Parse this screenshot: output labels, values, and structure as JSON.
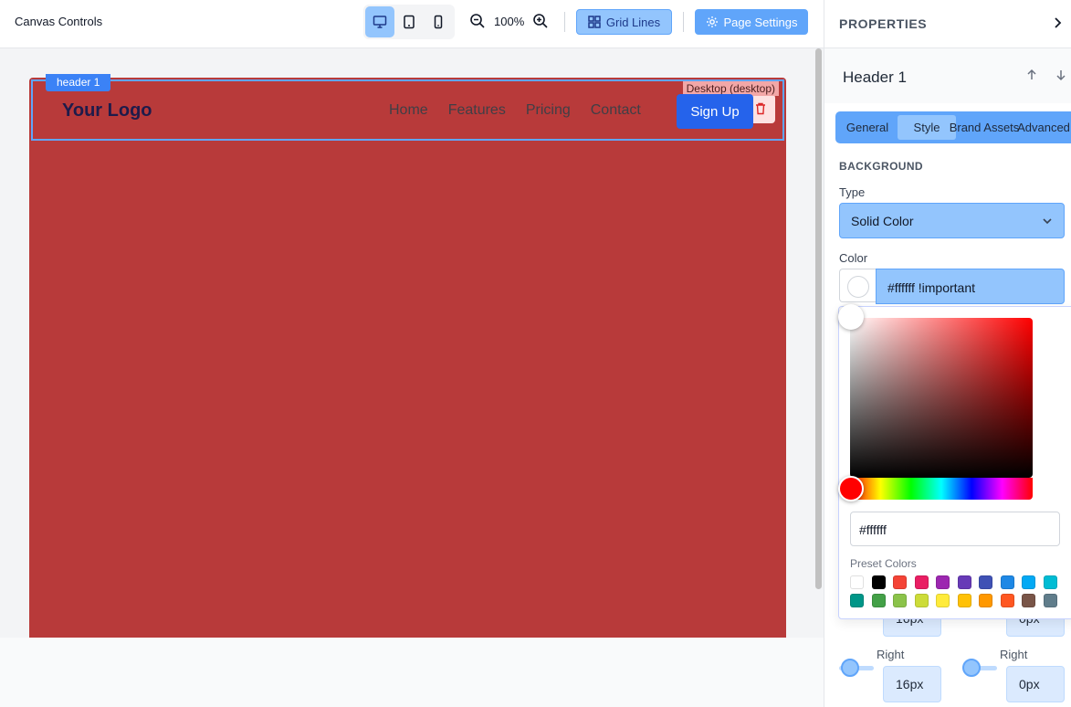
{
  "toolbar": {
    "title": "Canvas Controls",
    "zoom_level": "100%",
    "grid_lines_label": "Grid Lines",
    "page_settings_label": "Page Settings",
    "active_device": "desktop"
  },
  "canvas": {
    "header_tag": "header 1",
    "device_tag": "Desktop (desktop)",
    "logo": "Your Logo",
    "nav": [
      "Home",
      "Features",
      "Pricing",
      "Contact"
    ],
    "cta": "Sign Up",
    "header_bg": "#b83a3a"
  },
  "panel": {
    "title": "PROPERTIES",
    "component_name": "Header 1",
    "tabs": [
      "General",
      "Style",
      "Brand Assets",
      "Advanced"
    ],
    "active_tab": "Style",
    "section": "BACKGROUND",
    "type_label": "Type",
    "type_value": "Solid Color",
    "color_label": "Color",
    "color_value": "#ffffff !important",
    "padding": {
      "left_value_a": "16px",
      "left_value_b": "0px",
      "right_label": "Right",
      "right_value_a": "16px",
      "right_value_b": "0px"
    }
  },
  "picker": {
    "hex": "#ffffff",
    "preset_label": "Preset Colors",
    "presets": [
      "#ffffff",
      "#000000",
      "#f44336",
      "#e91e63",
      "#9c27b0",
      "#673ab7",
      "#3f51b5",
      "#1e88e5",
      "#03a9f4",
      "#00bcd4",
      "#009688",
      "#43a047",
      "#8bc34a",
      "#cddc39",
      "#ffeb3b",
      "#ffc107",
      "#ff9800",
      "#ff5722",
      "#795548",
      "#607d8b"
    ]
  }
}
